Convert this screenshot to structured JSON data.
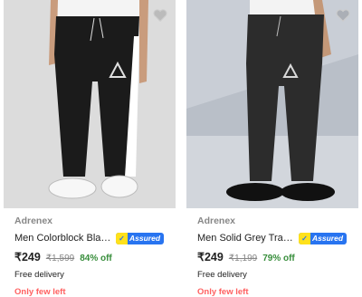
{
  "products": [
    {
      "brand": "Adrenex",
      "title": "Men Colorblock Black T...",
      "assured": "Assured",
      "price": "₹249",
      "mrp": "₹1,599",
      "discount": "84% off",
      "delivery": "Free delivery",
      "stock_note": "Only few left",
      "image_icon": "heart-icon"
    },
    {
      "brand": "Adrenex",
      "title": "Men Solid Grey Track P...",
      "assured": "Assured",
      "price": "₹249",
      "mrp": "₹1,199",
      "discount": "79% off",
      "delivery": "Free delivery",
      "stock_note": "Only few left",
      "image_icon": "heart-icon"
    }
  ],
  "colors": {
    "assured_blue": "#2874f0",
    "assured_yellow": "#ffe11b",
    "discount_green": "#388e3c",
    "stock_red": "#ff6161"
  }
}
